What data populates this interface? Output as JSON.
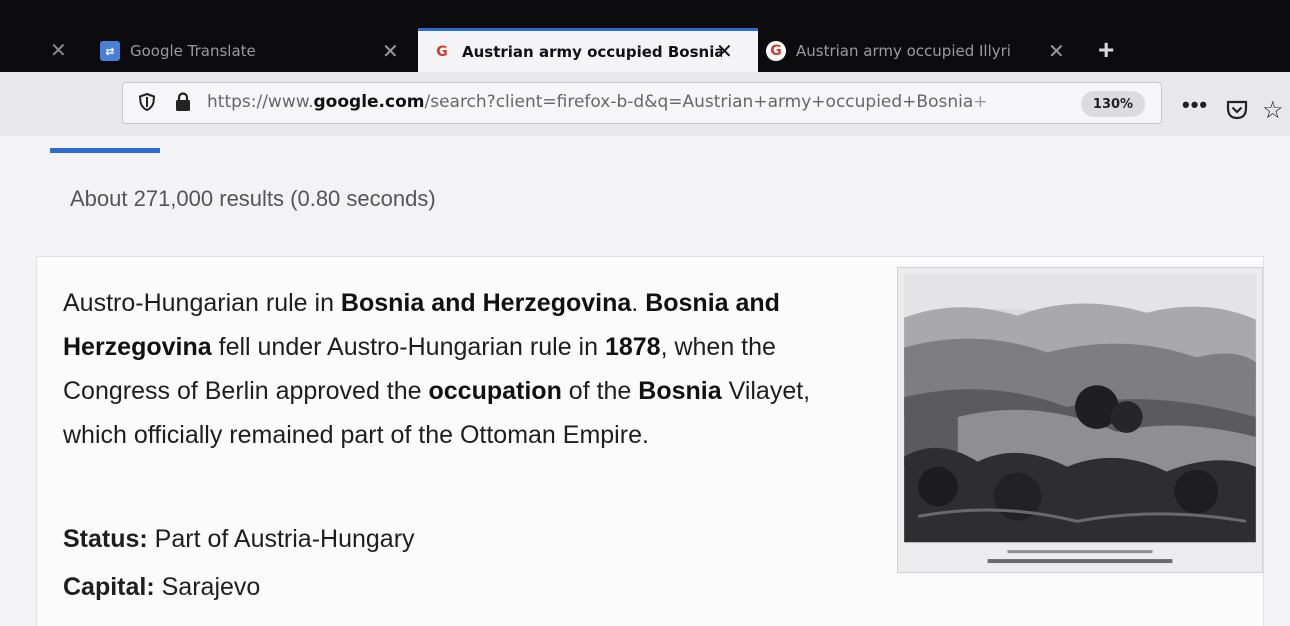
{
  "browser": {
    "tabs": [
      {
        "title": "Google Translate",
        "active": false
      },
      {
        "title": "Austrian army occupied Bosnia",
        "active": true
      },
      {
        "title": "Austrian army occupied Illyri",
        "active": false
      }
    ],
    "url_prefix": "https://www.",
    "url_host": "google.com",
    "url_path": "/search?client=firefox-b-d&q=Austrian+army+occupied+Bosnia",
    "url_tail": "+",
    "zoom": "130%"
  },
  "search": {
    "result_stats": "About 271,000 results (0.80 seconds)"
  },
  "knowledge_panel": {
    "s1_a": "Austro-Hungarian rule in ",
    "s1_b": "Bosnia and Herzegovina",
    "s1_c": ".",
    "s2_a": "Bosnia and Herzegovina",
    "s2_b": " fell under Austro-Hungarian rule in ",
    "s2_c": "1878",
    "s2_d": ", when the Congress of Berlin approved the ",
    "s2_e": "occupation",
    "s2_f": " of the ",
    "s2_g": "Bosnia",
    "s2_h": " Vilayet, which officially remained part of the Ottoman Empire.",
    "facts": [
      {
        "label": "Status:",
        "value": " Part of Austria-Hungary"
      },
      {
        "label": "Capital:",
        "value": " Sarajevo"
      }
    ]
  },
  "icons": {
    "translate_favicon": "google-translate-icon",
    "google_favicon": "google-g-icon",
    "shield": "shield-icon",
    "lock": "lock-icon",
    "more": "more-icon",
    "pocket": "pocket-icon",
    "star": "star-icon"
  },
  "colors": {
    "accent": "#2d6bd1",
    "tabstrip": "#0c0c0e"
  }
}
